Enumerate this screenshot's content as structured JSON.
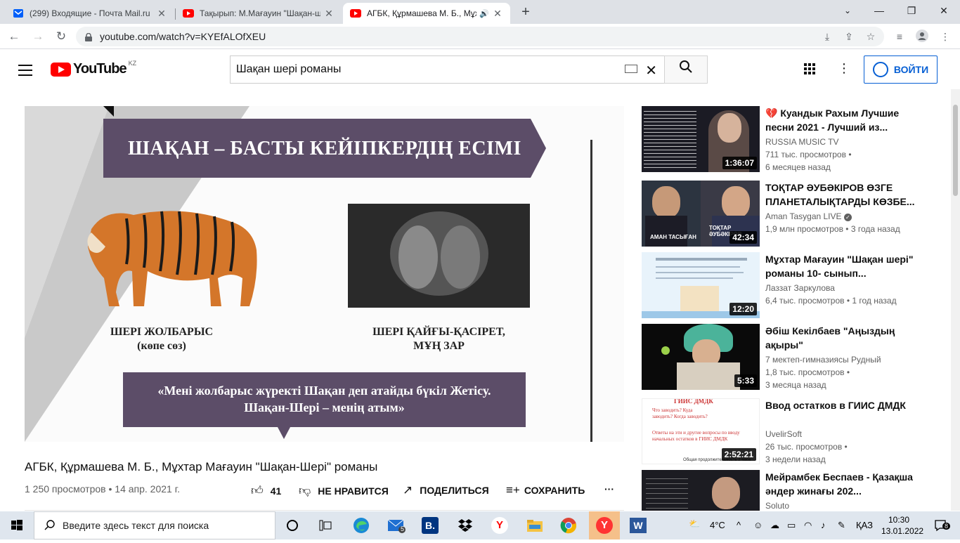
{
  "browser": {
    "tabs": [
      {
        "title": "(299) Входящие - Почта Mail.ru",
        "icon": "mail-icon"
      },
      {
        "title": "Тақырып: М.Мағауин \"Шақан-ш",
        "icon": "youtube-icon"
      },
      {
        "title": "АГБК, Құрмашева М. Б., Мұх",
        "icon": "youtube-icon",
        "audio": "speaker-icon"
      }
    ],
    "url": "youtube.com/watch?v=KYEfALOfXEU"
  },
  "youtube": {
    "logo": "YouTube",
    "country": "KZ",
    "search_value": "Шақан шері романы",
    "signin_label": "ВОЙТИ"
  },
  "slide": {
    "title": "ШАҚАН – БАСТЫ КЕЙІПКЕРДІҢ ЕСІМІ",
    "left_caption_1": "ШЕРІ ЖОЛБАРЫС",
    "left_caption_2": "(көпе сөз)",
    "right_caption_1": "ШЕРІ ҚАЙҒЫ-ҚАСІРЕТ,",
    "right_caption_2": "МҰҢ ЗАР",
    "quote_1": "«Мені жолбарыс жүректі Шақан деп атайды бүкіл Жетісу.",
    "quote_2": "Шақан-Шері – менің атым»"
  },
  "video": {
    "title": "АГБК, Құрмашева М. Б., Мұхтар Мағауин \"Шақан-Шері\" романы",
    "meta": "1 250 просмотров • 14 апр. 2021 г.",
    "likes": "41",
    "dislike": "НЕ НРАВИТСЯ",
    "share": "ПОДЕЛИТЬСЯ",
    "save": "СОХРАНИТЬ"
  },
  "recommendations": [
    {
      "title": "💔 Куандык Рахым Лучшие песни 2021 - Лучший из...",
      "channel": "RUSSIA MUSIC TV",
      "views": "711 тыс. просмотров •",
      "age": "6 месяцев назад",
      "duration": "1:36:07"
    },
    {
      "title": "ТОҚТАР ӘУБӘКІРОВ ӨЗГЕ ПЛАНЕТАЛЫҚТАРДЫ КӨЗБЕ...",
      "channel": "Aman Tasygan LIVE",
      "views": "1,9 млн просмотров • 3 года назад",
      "age": "",
      "duration": "42:34",
      "thumb_text_1": "АМАН ТАСЫҒАН",
      "thumb_text_2": "ТОҚТАР ӘУБӘКІРОВ"
    },
    {
      "title": "Мұхтар Мағауин \"Шақан шері\" романы 10- сынып...",
      "channel": "Лаззат Заркулова",
      "views": "6,4 тыс. просмотров • 1 год назад",
      "age": "",
      "duration": "12:20"
    },
    {
      "title": "Әбіш Кекілбаев \"Аңыздың ақыры\"",
      "channel": "7 мектеп-гимназиясы Рудный",
      "views": "1,8 тыс. просмотров •",
      "age": "3 месяца назад",
      "duration": "5:33"
    },
    {
      "title": "Ввод остатков в ГИИС ДМДК",
      "channel": "UvelirSoft",
      "views": "26 тыс. просмотров •",
      "age": "3 недели назад",
      "duration": "2:52:21",
      "thumb_text_1": "ГИИС ДМДК",
      "thumb_text_2": "Что заводить? Куда заводить? Когда заводить?",
      "thumb_text_3": "Ответы на эти и другие вопросы по вводу начальных остатков в ГИИС ДМДК",
      "thumb_text_4": "Общая продолжительность 2 часа"
    },
    {
      "title": "Мейрамбек Беспаев - Қазақша әндер жинағы 202...",
      "channel": "Soluto",
      "views": "",
      "age": "",
      "duration": ""
    }
  ],
  "taskbar": {
    "search_placeholder": "Введите здесь текст для поиска",
    "mail_badge": "5",
    "temperature": "4°C",
    "lang": "ҚАЗ",
    "time": "10:30",
    "date": "13.01.2022",
    "notif_count": "8"
  }
}
